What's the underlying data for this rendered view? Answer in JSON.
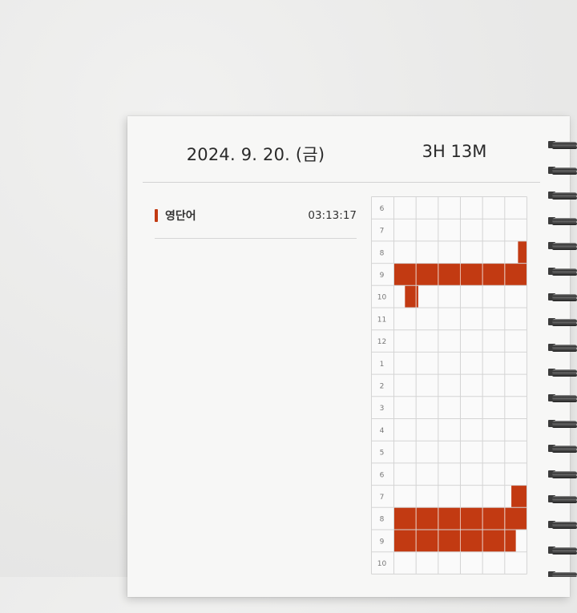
{
  "header": {
    "date": "2024. 9. 20. (금)",
    "total_time": "3H 13M"
  },
  "subjects": [
    {
      "name": "영단어",
      "time": "03:13:17",
      "color": "#c23a12"
    }
  ],
  "timetable": {
    "hour_labels": [
      "6",
      "7",
      "8",
      "9",
      "10",
      "11",
      "12",
      "1",
      "2",
      "3",
      "4",
      "5",
      "6",
      "7",
      "8",
      "9",
      "10"
    ],
    "minutes_per_cell": 10,
    "fill_color": "#c23a12",
    "sessions": [
      {
        "row": 2,
        "start_min": 56,
        "end_min": 60
      },
      {
        "row": 3,
        "start_min": 0,
        "end_min": 60
      },
      {
        "row": 4,
        "start_min": 5,
        "end_min": 11
      },
      {
        "row": 13,
        "start_min": 53,
        "end_min": 60
      },
      {
        "row": 14,
        "start_min": 0,
        "end_min": 60
      },
      {
        "row": 15,
        "start_min": 0,
        "end_min": 55
      }
    ]
  }
}
